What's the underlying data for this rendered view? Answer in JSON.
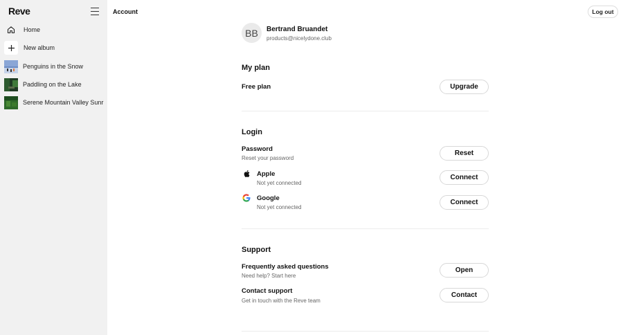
{
  "app": {
    "logo": "Reve"
  },
  "sidebar": {
    "items": [
      {
        "label": "Home"
      },
      {
        "label": "New album"
      }
    ],
    "albums": [
      {
        "label": "Penguins in the Snow"
      },
      {
        "label": "Paddling on the Lake"
      },
      {
        "label": "Serene Mountain Valley Sunrise"
      }
    ]
  },
  "header": {
    "title": "Account",
    "logout_label": "Log out"
  },
  "profile": {
    "initials": "BB",
    "name": "Bertrand Bruandet",
    "email": "products@nicelydone.club"
  },
  "plan": {
    "section_title": "My plan",
    "current": "Free plan",
    "upgrade_label": "Upgrade"
  },
  "login": {
    "section_title": "Login",
    "password": {
      "title": "Password",
      "subtitle": "Reset your password",
      "button": "Reset"
    },
    "apple": {
      "title": "Apple",
      "subtitle": "Not yet connected",
      "button": "Connect"
    },
    "google": {
      "title": "Google",
      "subtitle": "Not yet connected",
      "button": "Connect"
    }
  },
  "support": {
    "section_title": "Support",
    "faq": {
      "title": "Frequently asked questions",
      "subtitle": "Need help? Start here",
      "button": "Open"
    },
    "contact": {
      "title": "Contact support",
      "subtitle": "Get in touch with the Reve team",
      "button": "Contact"
    }
  },
  "colors": {
    "sidebar_bg": "#f1f1f1",
    "button_border": "#d8d8d8",
    "muted_text": "#666666"
  }
}
